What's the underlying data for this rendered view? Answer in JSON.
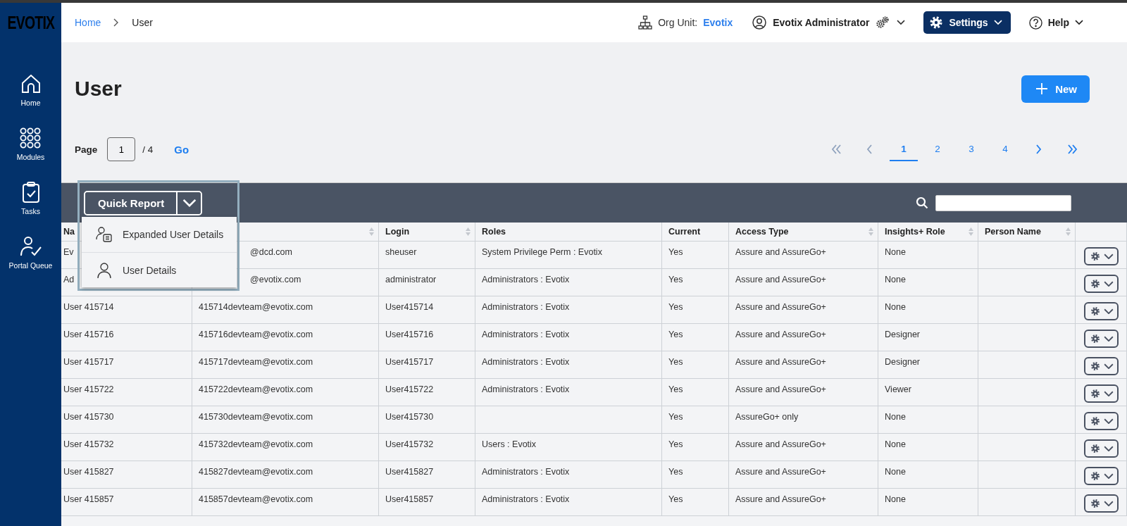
{
  "sidebar": {
    "logo": "EVOTIX",
    "items": [
      {
        "label": "Home"
      },
      {
        "label": "Modules"
      },
      {
        "label": "Tasks"
      },
      {
        "label": "Portal Queue"
      }
    ]
  },
  "breadcrumb": [
    {
      "label": "Home",
      "kind": "link"
    },
    {
      "label": "User",
      "kind": "current"
    }
  ],
  "header": {
    "org_label": "Org Unit:",
    "org_value": "Evotix",
    "user": "Evotix Administrator",
    "settings": "Settings",
    "help": "Help"
  },
  "page": {
    "title": "User",
    "new_button": "New"
  },
  "pager": {
    "label": "Page",
    "value": "1",
    "total": "/ 4",
    "go": "Go",
    "nav": [
      {
        "kind": "first",
        "disabled": true
      },
      {
        "kind": "prev",
        "disabled": true
      },
      {
        "kind": "next",
        "disabled": false
      },
      {
        "kind": "last",
        "disabled": false
      }
    ],
    "pages": [
      {
        "label": "1",
        "selected": true
      },
      {
        "label": "2",
        "selected": false
      },
      {
        "label": "3",
        "selected": false
      },
      {
        "label": "4",
        "selected": false
      }
    ]
  },
  "quick_report": {
    "label": "Quick Report",
    "expanded": true,
    "items": [
      {
        "label": "Expanded User Details"
      },
      {
        "label": "User Details"
      }
    ]
  },
  "table": {
    "columns": [
      {
        "label": "Na"
      },
      {
        "sortable": true
      },
      {
        "label": "Login",
        "sortable": true
      },
      {
        "label": "Roles",
        "sortable": false
      },
      {
        "label": "Current",
        "sortable": false
      },
      {
        "label": "Access Type",
        "sortable": true
      },
      {
        "label": "Insights+ Role",
        "sortable": true
      },
      {
        "label": "Person Name",
        "sortable": true
      }
    ],
    "rows": [
      {
        "cells": [
          "Ev",
          "@dcd.com",
          "sheuser",
          "System Privilege Perm : Evotix",
          "Yes",
          "Assure and AssureGo+",
          "None",
          ""
        ]
      },
      {
        "cells": [
          "Ad",
          "@evotix.com",
          "administrator",
          "Administrators : Evotix",
          "Yes",
          "Assure and AssureGo+",
          "None",
          ""
        ]
      },
      {
        "cells": [
          "User 415714",
          "415714devteam@evotix.com",
          "User415714",
          "Administrators : Evotix",
          "Yes",
          "Assure and AssureGo+",
          "None",
          ""
        ]
      },
      {
        "cells": [
          "User 415716",
          "415716devteam@evotix.com",
          "User415716",
          "Administrators : Evotix",
          "Yes",
          "Assure and AssureGo+",
          "Designer",
          ""
        ]
      },
      {
        "cells": [
          "User 415717",
          "415717devteam@evotix.com",
          "User415717",
          "Administrators : Evotix",
          "Yes",
          "Assure and AssureGo+",
          "Designer",
          ""
        ]
      },
      {
        "cells": [
          "User 415722",
          "415722devteam@evotix.com",
          "User415722",
          "Administrators : Evotix",
          "Yes",
          "Assure and AssureGo+",
          "Viewer",
          ""
        ]
      },
      {
        "cells": [
          "User 415730",
          "415730devteam@evotix.com",
          "User415730",
          "",
          "Yes",
          "AssureGo+ only",
          "None",
          ""
        ]
      },
      {
        "cells": [
          "User 415732",
          "415732devteam@evotix.com",
          "User415732",
          "Users : Evotix",
          "Yes",
          "Assure and AssureGo+",
          "None",
          ""
        ]
      },
      {
        "cells": [
          "User 415827",
          "415827devteam@evotix.com",
          "User415827",
          "Administrators : Evotix",
          "Yes",
          "Assure and AssureGo+",
          "None",
          ""
        ]
      },
      {
        "cells": [
          "User 415857",
          "415857devteam@evotix.com",
          "User415857",
          "Administrators : Evotix",
          "Yes",
          "Assure and AssureGo+",
          "None",
          ""
        ]
      }
    ]
  }
}
